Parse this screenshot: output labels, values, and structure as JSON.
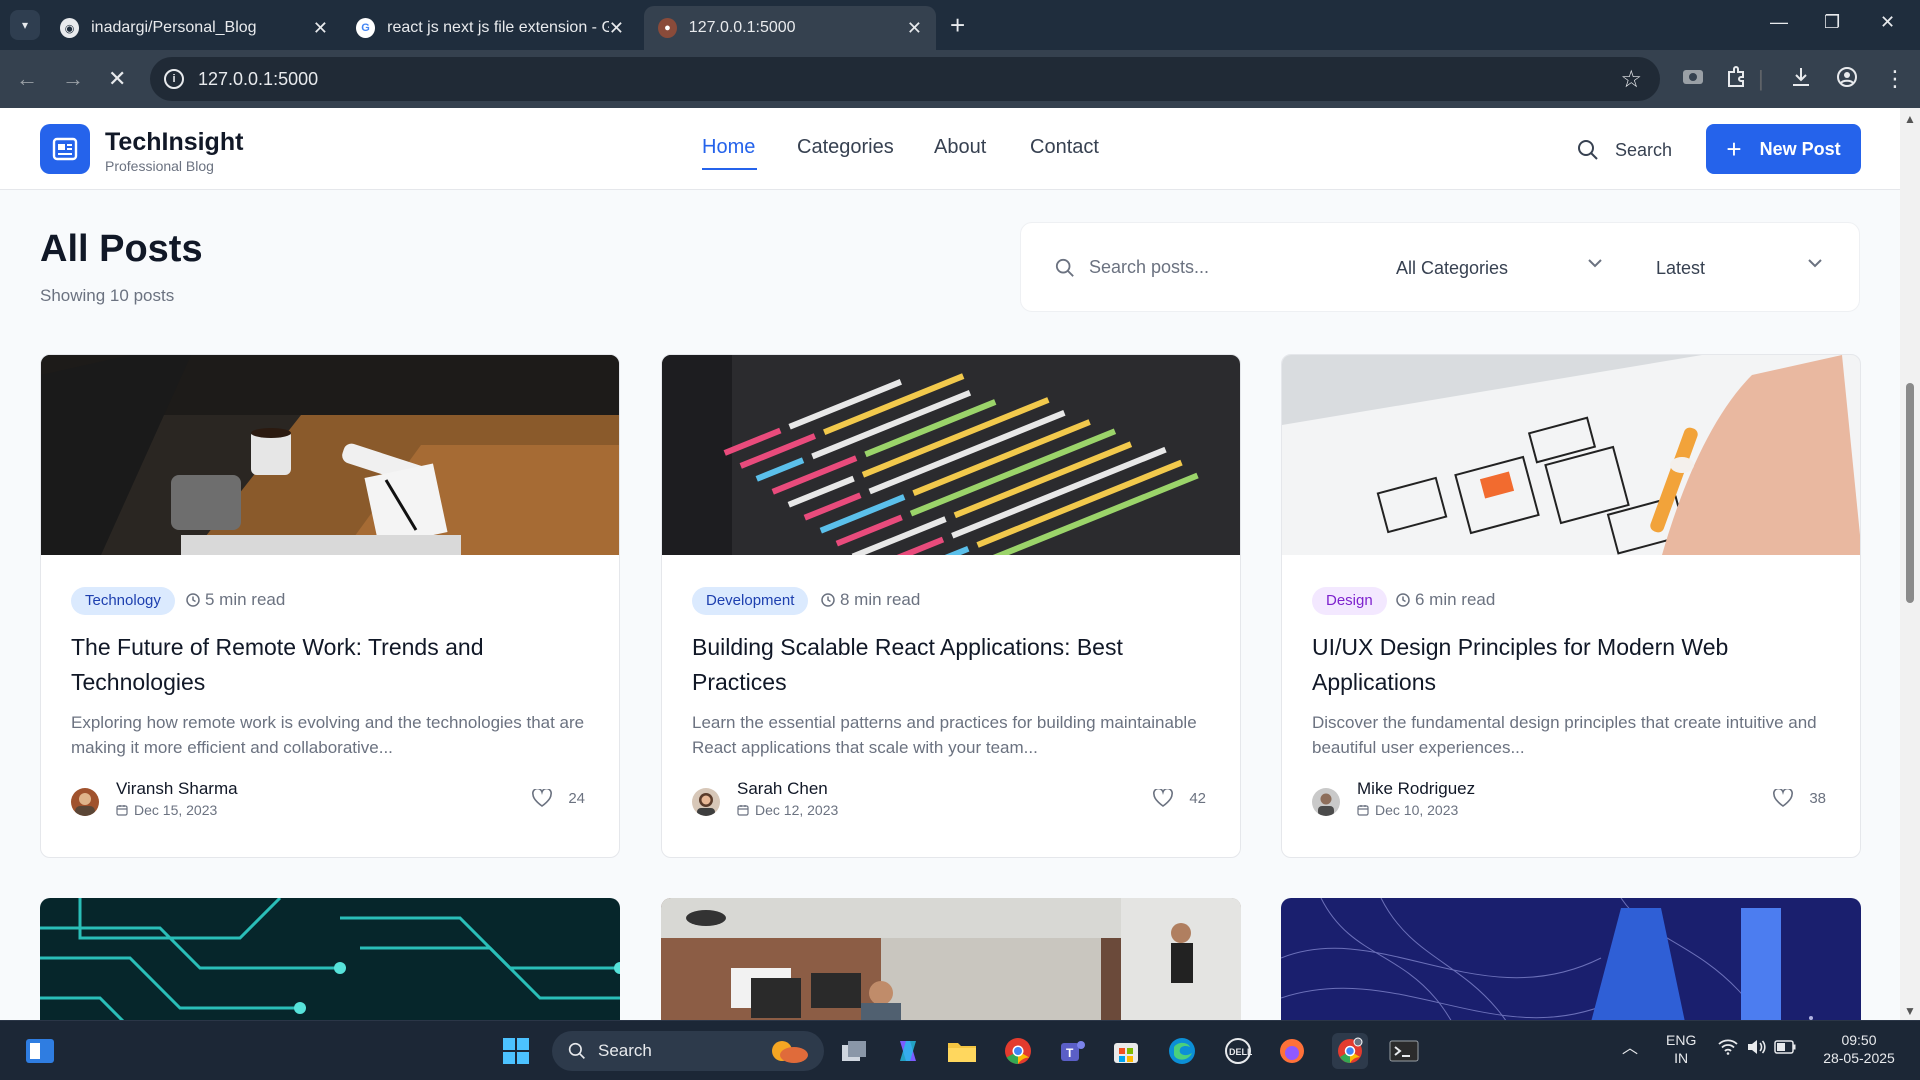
{
  "browser": {
    "tabs": [
      {
        "title": "inadargi/Personal_Blog",
        "icon": "github-icon"
      },
      {
        "title": "react js next js file extension - G",
        "icon": "google-icon"
      },
      {
        "title": "127.0.0.1:5000",
        "icon": "site-icon"
      }
    ],
    "url": "127.0.0.1:5000"
  },
  "site": {
    "brand": "TechInsight",
    "tagline": "Professional Blog",
    "nav": [
      "Home",
      "Categories",
      "About",
      "Contact"
    ],
    "search_label": "Search",
    "new_post_label": "New Post",
    "accent": "#2563eb"
  },
  "main": {
    "title": "All Posts",
    "count": "Showing 10 posts",
    "search_placeholder": "Search posts...",
    "category_select": "All Categories",
    "sort_select": "Latest"
  },
  "posts": [
    {
      "category": "Technology",
      "read_time": "5 min read",
      "title": "The Future of Remote Work: Trends and Technologies",
      "excerpt": "Exploring how remote work is evolving and the technologies that are making it more efficient and collaborative...",
      "author": "Viransh Sharma",
      "date": "Dec 15, 2023",
      "likes": "24"
    },
    {
      "category": "Development",
      "read_time": "8 min read",
      "title": "Building Scalable React Applications: Best Practices",
      "excerpt": "Learn the essential patterns and practices for building maintainable React applications that scale with your team...",
      "author": "Sarah Chen",
      "date": "Dec 12, 2023",
      "likes": "42"
    },
    {
      "category": "Design",
      "read_time": "6 min read",
      "title": "UI/UX Design Principles for Modern Web Applications",
      "excerpt": "Discover the fundamental design principles that create intuitive and beautiful user experiences...",
      "author": "Mike Rodriguez",
      "date": "Dec 10, 2023",
      "likes": "38"
    }
  ],
  "taskbar": {
    "search_label": "Search",
    "lang": "ENG",
    "region": "IN",
    "time": "09:50",
    "date": "28-05-2025"
  }
}
